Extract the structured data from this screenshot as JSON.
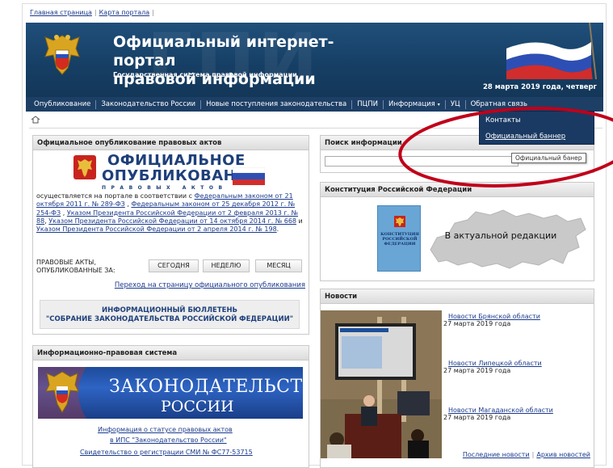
{
  "top_links": [
    "Главная страница",
    "Карта портала"
  ],
  "header": {
    "bg_letters": "ГПИ",
    "title_line1": "Официальный интернет-портал",
    "title_line2": "правовой информации",
    "subtitle": "Государственная система правовой информации",
    "date": "28 марта 2019 года, четверг"
  },
  "nav": {
    "items": [
      "Опубликование",
      "Законодательство России",
      "Новые поступления законодательства",
      "ПЦПИ",
      "Информация",
      "УЦ",
      "Обратная связь"
    ],
    "caret": "▾"
  },
  "dropdown": {
    "items": [
      "Контакты",
      "Официальный баннер"
    ],
    "tooltip": "Официальный банер"
  },
  "official_publication": {
    "header": "Официальное опубликование правовых актов",
    "logo_line1": "ОФИЦИАЛЬНОЕ",
    "logo_line2": "ОПУБЛИКОВАНИЕ",
    "logo_sub": "ПРАВОВЫХ АКТОВ",
    "text_pre": "осуществляется на портале в соответствии с ",
    "link1": "Федеральным законом от 21 октября 2011 г. № 289-ФЗ",
    "sep1": " , ",
    "link2": "Федеральным законом от 25 декабря 2012 г. № 254-ФЗ",
    "sep2": " , ",
    "link3": "Указом Президента Российской Федерации от 2 февраля 2013 г. № 88",
    "sep3": ", ",
    "link4": "Указом Президента Российской Федерации от 14 октября 2014 г. № 668",
    "sep4": " и ",
    "link5": "Указом Президента Российской Федерации от 2 апреля 2014 г. № 198",
    "text_end": ".",
    "period_label": "ПРАВОВЫЕ АКТЫ, ОПУБЛИКОВАННЫЕ ЗА:",
    "btn_today": "СЕГОДНЯ",
    "btn_week": "НЕДЕЛЮ",
    "btn_month": "МЕСЯЦ",
    "goto_link": "Переход на страницу официального опубликования",
    "bulletin_line1": "ИНФОРМАЦИОННЫЙ БЮЛЛЕТЕНЬ",
    "bulletin_line2": "\"СОБРАНИЕ ЗАКОНОДАТЕЛЬСТВА РОССИЙСКОЙ ФЕДЕРАЦИИ\""
  },
  "legal_system": {
    "header": "Информационно-правовая система",
    "banner_line1": "ЗАКОНОДАТЕЛЬСТВО",
    "banner_line2": "РОССИИ",
    "link_status1": "Информация о статусе правовых актов",
    "link_status2": "в ИПС \"Законодательство России\"",
    "link_cert": "Свидетельство о регистрации СМИ № ФС77-53715"
  },
  "search": {
    "header": "Поиск информации"
  },
  "constitution": {
    "header": "Конституция Российской Федерации",
    "book_title": "КОНСТИТУЦИЯ РОССИЙСКОЙ ФЕДЕРАЦИИ",
    "map_text": "В актуальной редакции"
  },
  "news": {
    "header": "Новости",
    "items": [
      {
        "title": "Новости Брянской области",
        "date": "27 марта 2019 года"
      },
      {
        "title": "Новости Липецкой области",
        "date": "27 марта 2019 года"
      },
      {
        "title": "Новости Магаданской области",
        "date": "27 марта 2019 года"
      }
    ],
    "latest_link": "Последние новости",
    "archive_link": "Архив новостей"
  },
  "colors": {
    "header_blue": "#1f4f7a",
    "nav_blue": "#1d3f66",
    "link_blue": "#1a3a8c",
    "annotation_red": "#c0001a"
  }
}
